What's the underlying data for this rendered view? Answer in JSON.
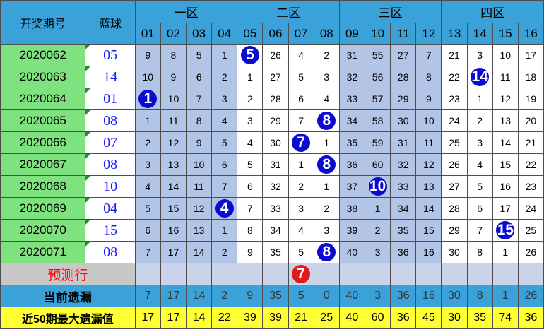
{
  "chart_data": {
    "type": "table",
    "header": {
      "period_label": "开奖期号",
      "blue_label": "蓝球",
      "zones": [
        "一区",
        "二区",
        "三区",
        "四区"
      ],
      "numbers": [
        "01",
        "02",
        "03",
        "04",
        "05",
        "06",
        "07",
        "08",
        "09",
        "10",
        "11",
        "12",
        "13",
        "14",
        "15",
        "16"
      ]
    },
    "rows": [
      {
        "period": "2020062",
        "blue": "05",
        "cells": [
          "9",
          "8",
          "5",
          "1",
          "5",
          "26",
          "4",
          "2",
          "31",
          "55",
          "27",
          "7",
          "21",
          "3",
          "10",
          "17"
        ],
        "hit": 4
      },
      {
        "period": "2020063",
        "blue": "14",
        "cells": [
          "10",
          "9",
          "6",
          "2",
          "1",
          "27",
          "5",
          "3",
          "32",
          "56",
          "28",
          "8",
          "22",
          "14",
          "11",
          "18"
        ],
        "hit": 13
      },
      {
        "period": "2020064",
        "blue": "01",
        "cells": [
          "1",
          "10",
          "7",
          "3",
          "2",
          "28",
          "6",
          "4",
          "33",
          "57",
          "29",
          "9",
          "23",
          "1",
          "12",
          "19"
        ],
        "hit": 0
      },
      {
        "period": "2020065",
        "blue": "08",
        "cells": [
          "1",
          "11",
          "8",
          "4",
          "3",
          "29",
          "7",
          "8",
          "34",
          "58",
          "30",
          "10",
          "24",
          "2",
          "13",
          "20"
        ],
        "hit": 7
      },
      {
        "period": "2020066",
        "blue": "07",
        "cells": [
          "2",
          "12",
          "9",
          "5",
          "4",
          "30",
          "7",
          "1",
          "35",
          "59",
          "31",
          "11",
          "25",
          "3",
          "14",
          "21"
        ],
        "hit": 6
      },
      {
        "period": "2020067",
        "blue": "08",
        "cells": [
          "3",
          "13",
          "10",
          "6",
          "5",
          "31",
          "1",
          "8",
          "36",
          "60",
          "32",
          "12",
          "26",
          "4",
          "15",
          "22"
        ],
        "hit": 7
      },
      {
        "period": "2020068",
        "blue": "10",
        "cells": [
          "4",
          "14",
          "11",
          "7",
          "6",
          "32",
          "2",
          "1",
          "37",
          "10",
          "33",
          "13",
          "27",
          "5",
          "16",
          "23"
        ],
        "hit": 9
      },
      {
        "period": "2020069",
        "blue": "04",
        "cells": [
          "5",
          "15",
          "12",
          "4",
          "7",
          "33",
          "3",
          "2",
          "38",
          "1",
          "34",
          "14",
          "28",
          "6",
          "17",
          "24"
        ],
        "hit": 3
      },
      {
        "period": "2020070",
        "blue": "15",
        "cells": [
          "6",
          "16",
          "13",
          "1",
          "8",
          "34",
          "4",
          "3",
          "39",
          "2",
          "35",
          "15",
          "29",
          "7",
          "15",
          "25"
        ],
        "hit": 14
      },
      {
        "period": "2020071",
        "blue": "08",
        "cells": [
          "7",
          "17",
          "14",
          "2",
          "9",
          "35",
          "5",
          "8",
          "40",
          "3",
          "36",
          "16",
          "30",
          "8",
          "1",
          "26"
        ],
        "hit": 7
      }
    ],
    "prediction": {
      "label": "预测行",
      "value": "7",
      "column": 6
    },
    "current_omission": {
      "label": "当前遗漏",
      "values": [
        "7",
        "17",
        "14",
        "2",
        "9",
        "35",
        "5",
        "0",
        "40",
        "3",
        "36",
        "16",
        "30",
        "8",
        "1",
        "26"
      ]
    },
    "max_omission_50": {
      "label": "近50期最大遗漏值",
      "values": [
        "17",
        "17",
        "14",
        "22",
        "39",
        "39",
        "21",
        "25",
        "40",
        "60",
        "36",
        "45",
        "30",
        "35",
        "74",
        "36"
      ]
    }
  },
  "colors": {
    "header": "#3ba2d9",
    "period": "#7ee27e",
    "zone_shaded": "#b3c5e6",
    "ball_blue": "#0a0ad1",
    "ball_red": "#e01b1b",
    "max_row": "#ffff33"
  }
}
